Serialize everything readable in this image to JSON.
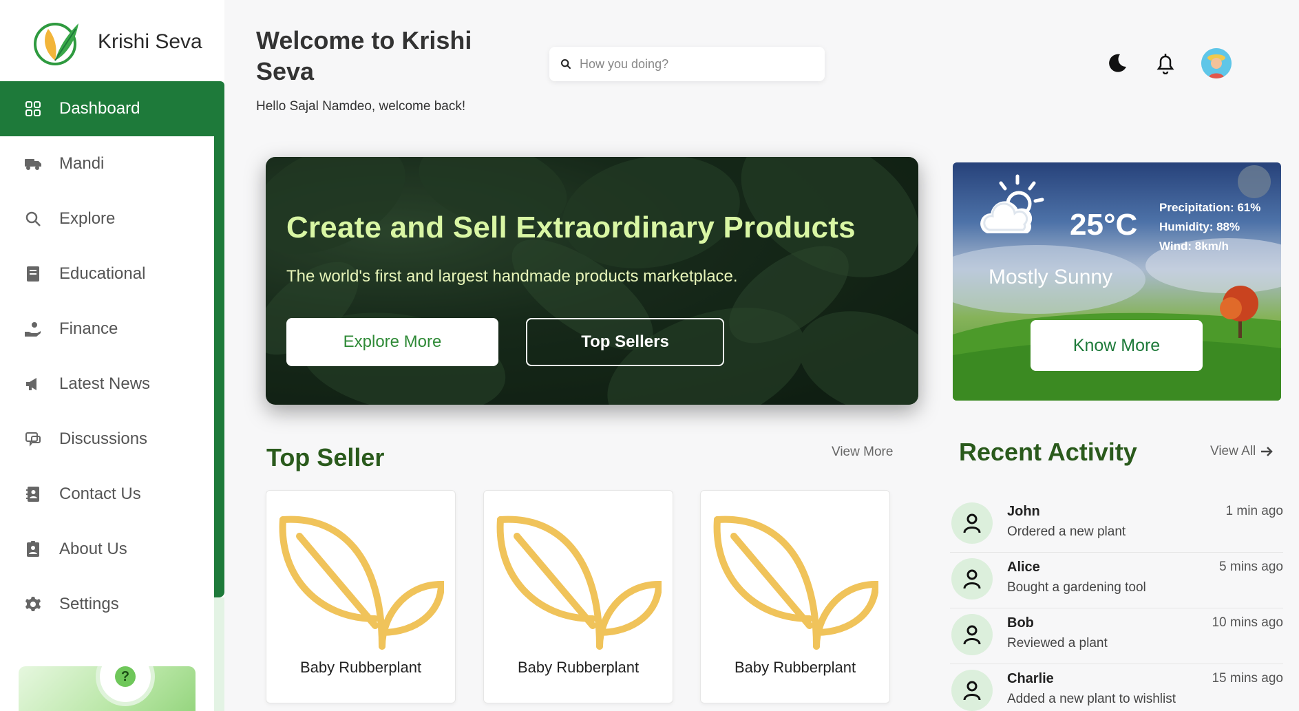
{
  "brand": {
    "name": "Krishi Seva"
  },
  "sidebar": {
    "items": [
      {
        "label": "Dashboard",
        "icon": "grid-icon",
        "active": true
      },
      {
        "label": "Mandi",
        "icon": "truck-icon"
      },
      {
        "label": "Explore",
        "icon": "search-icon"
      },
      {
        "label": "Educational",
        "icon": "book-icon"
      },
      {
        "label": "Finance",
        "icon": "hand-coin-icon"
      },
      {
        "label": "Latest News",
        "icon": "megaphone-icon"
      },
      {
        "label": "Discussions",
        "icon": "chat-icon"
      },
      {
        "label": "Contact Us",
        "icon": "contact-book-icon"
      },
      {
        "label": "About Us",
        "icon": "id-card-icon"
      },
      {
        "label": "Settings",
        "icon": "gear-icon"
      }
    ],
    "help": {
      "symbol": "?"
    }
  },
  "header": {
    "title": "Welcome to Krishi Seva",
    "subtitle": "Hello Sajal Namdeo, welcome back!",
    "search_placeholder": "How you doing?"
  },
  "hero": {
    "title": "Create and Sell Extraordinary Products",
    "subtitle": "The world's first and largest handmade products marketplace.",
    "primary_button": "Explore More",
    "secondary_button": "Top Sellers"
  },
  "weather": {
    "temperature": "25°C",
    "precipitation": "Precipitation: 61%",
    "humidity": "Humidity: 88%",
    "wind": "Wind: 8km/h",
    "condition": "Mostly Sunny",
    "button": "Know More"
  },
  "top_seller": {
    "title": "Top Seller",
    "link": "View More",
    "products": [
      {
        "name": "Baby Rubberplant"
      },
      {
        "name": "Baby Rubberplant"
      },
      {
        "name": "Baby Rubberplant"
      }
    ]
  },
  "activity": {
    "title": "Recent Activity",
    "link": "View All",
    "items": [
      {
        "name": "John",
        "action": "Ordered a new plant",
        "time": "1 min ago"
      },
      {
        "name": "Alice",
        "action": "Bought a gardening tool",
        "time": "5 mins ago"
      },
      {
        "name": "Bob",
        "action": "Reviewed a plant",
        "time": "10 mins ago"
      },
      {
        "name": "Charlie",
        "action": "Added a new plant to wishlist",
        "time": "15 mins ago"
      }
    ]
  },
  "colors": {
    "primary": "#1e7a3a",
    "heading": "#2a5a1c",
    "hero_title": "#d9f6a4",
    "leaf_icon": "#f0c35a"
  }
}
